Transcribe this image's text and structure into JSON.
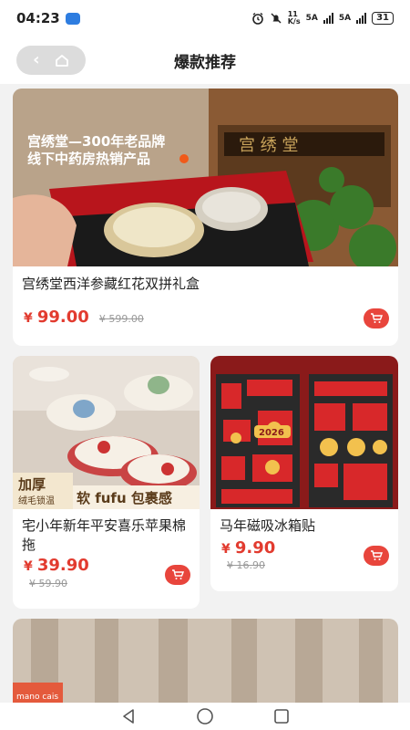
{
  "status": {
    "time": "04:23",
    "net1": "11\nK/s",
    "sig1": "5A",
    "sig2": "5A",
    "battery": "31"
  },
  "header": {
    "title": "爆款推荐"
  },
  "product1": {
    "name": "宫绣堂西洋参藏红花双拼礼盒",
    "currency": "¥",
    "price": "99.00",
    "old_price": "¥ 599.00",
    "banner_line1": "宫绣堂—300年老品牌",
    "banner_line2": "线下中药房热销产品",
    "sign_text": "宫 绣 堂"
  },
  "product2": {
    "name": "宅小年新年平安喜乐苹果棉拖",
    "currency": "¥",
    "price": "39.90",
    "old_price": "¥ 59.90",
    "badge_line1": "加厚",
    "badge_line2": "绒毛锁温",
    "slogan": "软 fufu 包裹感"
  },
  "product3": {
    "name": "马年磁吸冰箱贴",
    "currency": "¥",
    "price": "9.90",
    "old_price": "¥ 16.90",
    "tag_text": "2026"
  },
  "product4": {
    "brand_text": "mano cais"
  }
}
